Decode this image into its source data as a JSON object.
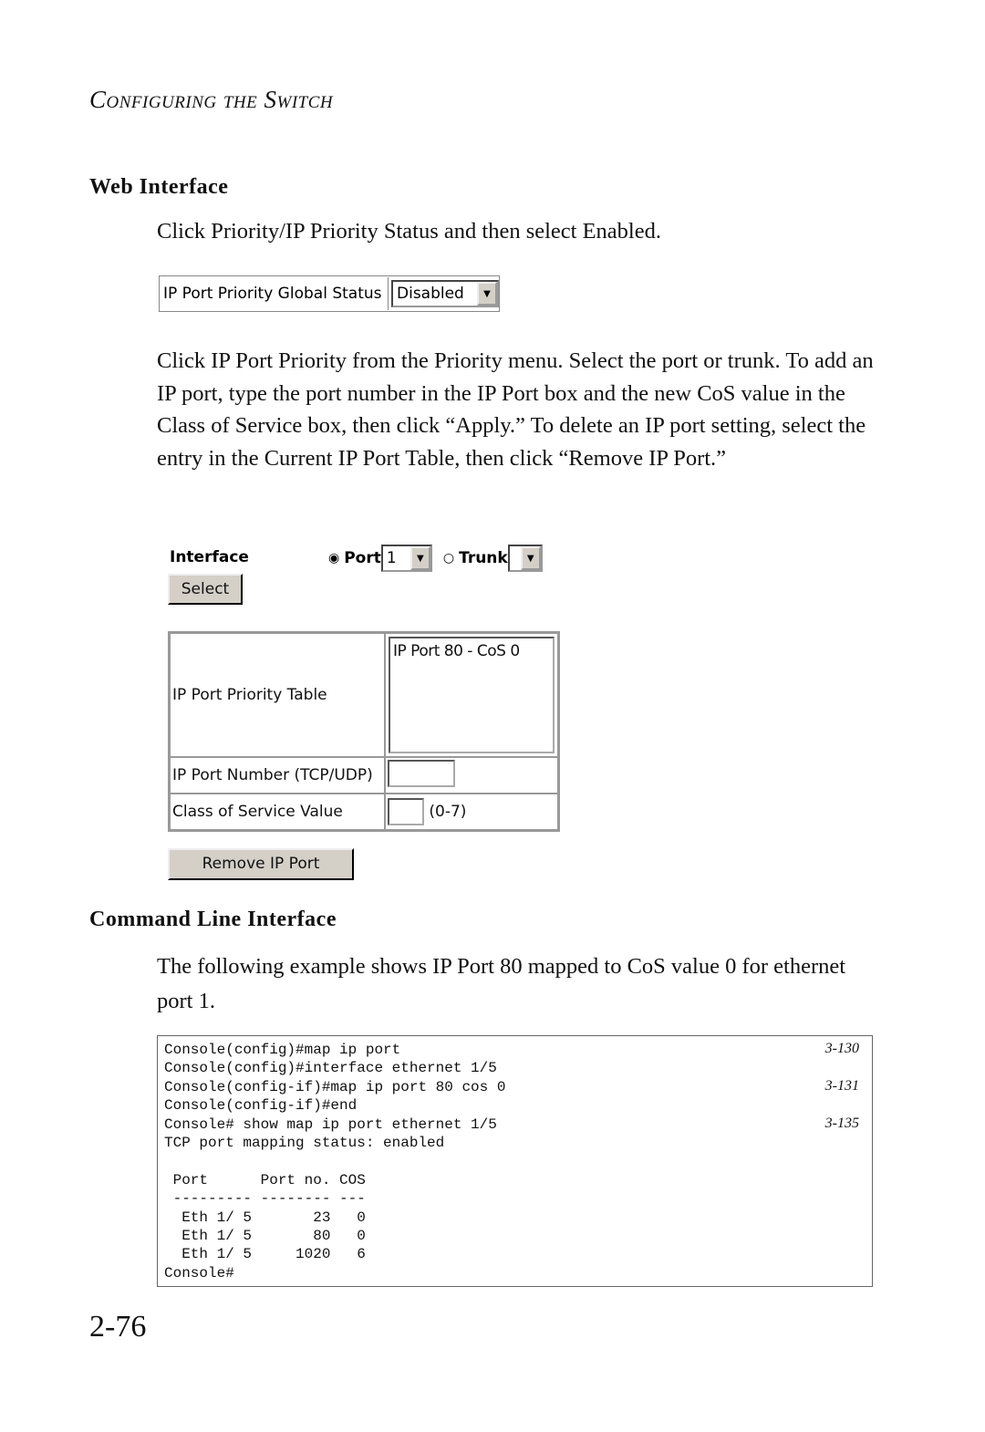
{
  "header": "Configuring the Switch",
  "web_heading": "Web Interface",
  "para1": "Click Priority/IP Priority Status and then select Enabled.",
  "global_status": {
    "label": "IP Port Priority Global Status",
    "value": "Disabled"
  },
  "para2": "Click IP Port Priority from the Priority menu. Select the port or trunk. To add an IP port, type the port number in the IP Port box and the new CoS value in the Class of Service box, then click “Apply.” To delete an IP port setting, select the entry in the Current IP Port Table, then click “Remove IP Port.”",
  "form": {
    "interface_label": "Interface",
    "port_label": "Port",
    "port_value": "1",
    "trunk_label": "Trunk",
    "trunk_value": "",
    "select_button": "Select",
    "table_label": "IP Port Priority Table",
    "table_entries": [
      "IP Port 80 - CoS 0"
    ],
    "port_number_label": "IP Port Number (TCP/UDP)",
    "port_number_value": "",
    "cos_label": "Class of Service Value",
    "cos_value": "",
    "cos_range": "(0-7)",
    "remove_button": "Remove IP Port"
  },
  "cli_heading": "Command Line Interface",
  "para3": "The following example shows IP Port 80 mapped to CoS value 0 for ethernet port 1.",
  "code": [
    {
      "text": "Console(config)#map ip port",
      "ref": "3-130"
    },
    {
      "text": "Console(config)#interface ethernet 1/5",
      "ref": ""
    },
    {
      "text": "Console(config-if)#map ip port 80 cos 0",
      "ref": "3-131"
    },
    {
      "text": "Console(config-if)#end",
      "ref": ""
    },
    {
      "text": "Console# show map ip port ethernet 1/5",
      "ref": "3-135"
    },
    {
      "text": "TCP port mapping status: enabled",
      "ref": ""
    },
    {
      "text": "",
      "ref": ""
    },
    {
      "text": " Port      Port no. COS",
      "ref": ""
    },
    {
      "text": " --------- -------- ---",
      "ref": ""
    },
    {
      "text": "  Eth 1/ 5       23   0",
      "ref": ""
    },
    {
      "text": "  Eth 1/ 5       80   0",
      "ref": ""
    },
    {
      "text": "  Eth 1/ 5     1020   6",
      "ref": ""
    },
    {
      "text": "Console#",
      "ref": ""
    }
  ],
  "page_number": "2-76"
}
